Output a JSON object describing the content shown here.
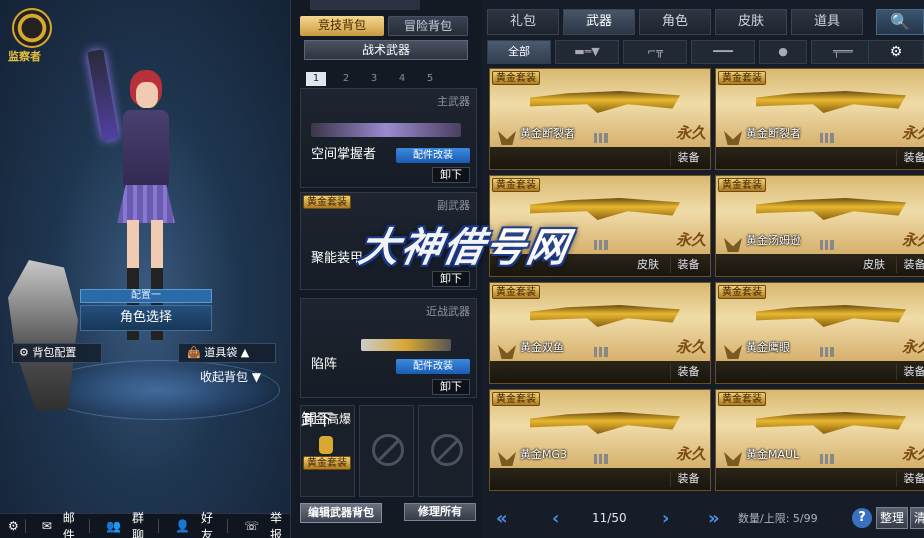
{
  "left": {
    "logo_text": "监察者",
    "config_tab": "配置一",
    "role_select": "角色选择",
    "bag_config": "背包配置",
    "tool_bag": "道具袋",
    "collapse": "收起背包",
    "bottom": {
      "mail": "邮件",
      "group_chat": "群聊",
      "friends": "好友",
      "report": "举报"
    }
  },
  "mid": {
    "mode_tabs": [
      "竞技背包",
      "冒险背包"
    ],
    "tactical": "战术武器",
    "num_tabs": [
      "1",
      "2",
      "3",
      "4",
      "5"
    ],
    "slots": {
      "primary": {
        "category": "主武器",
        "name": "空间掌握者",
        "mod": "配件改装",
        "unload": "卸下"
      },
      "secondary": {
        "category": "副武器",
        "tag": "黄金套装",
        "name": "聚能装甲",
        "unload": "卸下"
      },
      "melee": {
        "category": "近战武器",
        "name": "陷阵",
        "mod": "配件改装",
        "unload": "卸下"
      },
      "grenade": {
        "name": "黄金高爆",
        "tag": "黄金套装",
        "unload": "卸下"
      }
    },
    "edit_btn": "编辑武器背包",
    "repair_btn": "修理所有"
  },
  "right": {
    "top_tabs": [
      "礼包",
      "武器",
      "角色",
      "皮肤",
      "道具"
    ],
    "active_top_tab": "武器",
    "all_tab": "全部",
    "items": [
      {
        "name": "黄金断裂者",
        "tag": "黄金套装",
        "perm": "永久",
        "equip": "装备",
        "skin": ""
      },
      {
        "name": "黄金断裂者",
        "tag": "黄金套装",
        "perm": "永久",
        "equip": "装备",
        "skin": ""
      },
      {
        "name": "",
        "tag": "黄金套装",
        "perm": "永久",
        "equip": "装备",
        "skin": "皮肤"
      },
      {
        "name": "黄金汤姆逊",
        "tag": "黄金套装",
        "perm": "永久",
        "equip": "装备",
        "skin": "皮肤"
      },
      {
        "name": "黄金双鱼",
        "tag": "黄金套装",
        "perm": "永久",
        "equip": "装备",
        "skin": ""
      },
      {
        "name": "黄金鹰眼",
        "tag": "黄金套装",
        "perm": "永久",
        "equip": "装备",
        "skin": ""
      },
      {
        "name": "黄金MG3",
        "tag": "黄金套装",
        "perm": "永久",
        "equip": "装备",
        "skin": ""
      },
      {
        "name": "黄金MAUL",
        "tag": "黄金套装",
        "perm": "永久",
        "equip": "装备",
        "skin": ""
      }
    ],
    "pager": {
      "page": "11/50",
      "quantity": "数量/上限: 5/99",
      "help": "?",
      "sort": "整理",
      "clear": "清"
    }
  },
  "watermark": "大神借号网"
}
